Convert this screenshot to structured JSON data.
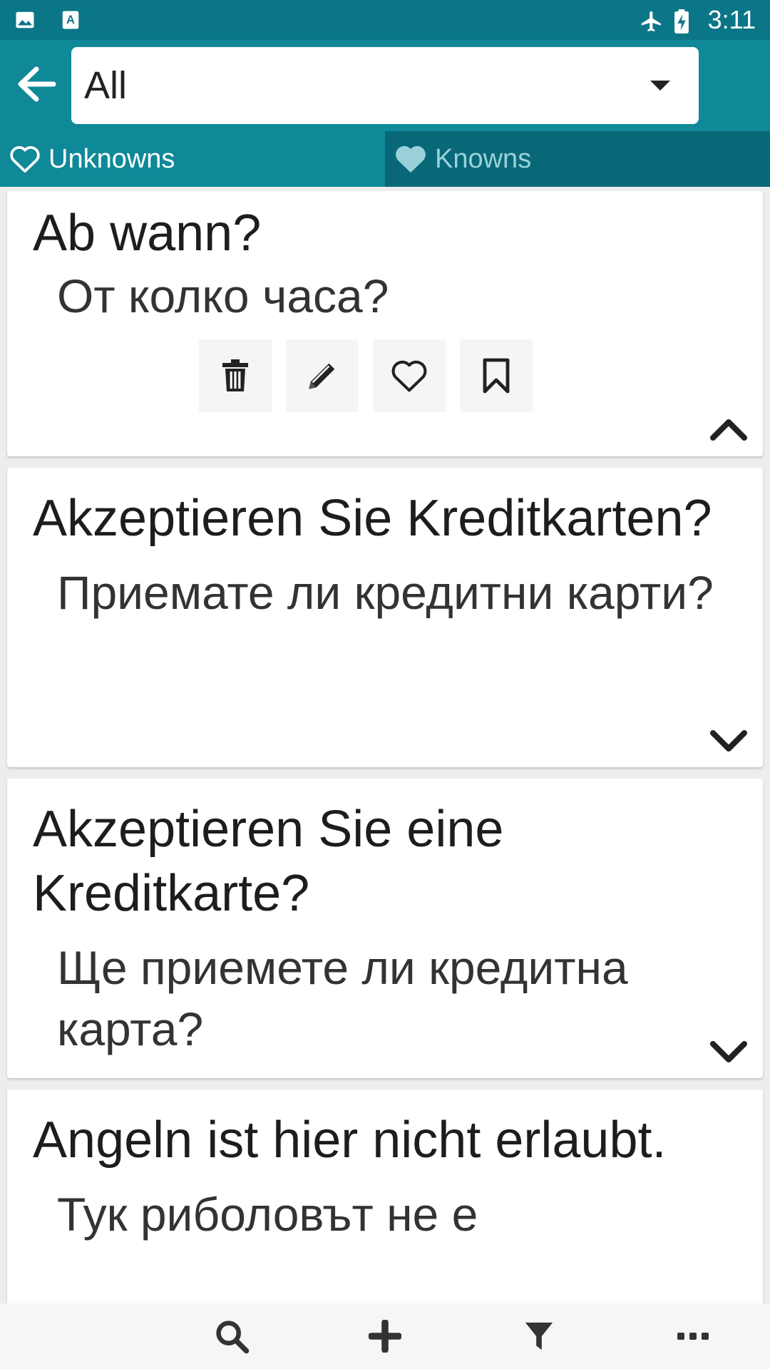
{
  "status_bar": {
    "time": "3:11",
    "icons": [
      "image-icon",
      "font-a-icon",
      "airplane-mode-icon",
      "battery-charging-icon"
    ]
  },
  "toolbar": {
    "back_icon": "arrow-left-icon",
    "filter_value": "All"
  },
  "tabs": [
    {
      "label": "Unknowns",
      "icon": "heart-outline-icon",
      "selected": true
    },
    {
      "label": "Knowns",
      "icon": "heart-filled-icon",
      "selected": false
    }
  ],
  "cards": [
    {
      "term": "Ab wann?",
      "translation": "От колко часа?",
      "expanded": true,
      "actions": [
        "trash-icon",
        "pencil-icon",
        "heart-outline-icon",
        "bookmark-icon"
      ]
    },
    {
      "term": "Akzeptieren Sie Kreditkarten?",
      "translation": "Приемате ли кредитни карти?",
      "expanded": false
    },
    {
      "term": "Akzeptieren Sie eine Kreditkarte?",
      "translation": "Ще приемете ли кредитна карта?",
      "expanded": false
    },
    {
      "term": "Angeln ist hier nicht erlaubt.",
      "translation": "Тук риболовът не е",
      "expanded": false
    }
  ],
  "bottom_nav": [
    "search-icon",
    "plus-icon",
    "filter-icon",
    "more-icon"
  ],
  "colors": {
    "status_bar": "#0a7688",
    "toolbar": "#0f8898",
    "tab_selected": "#0f8898",
    "tab_unselected": "#086878"
  }
}
